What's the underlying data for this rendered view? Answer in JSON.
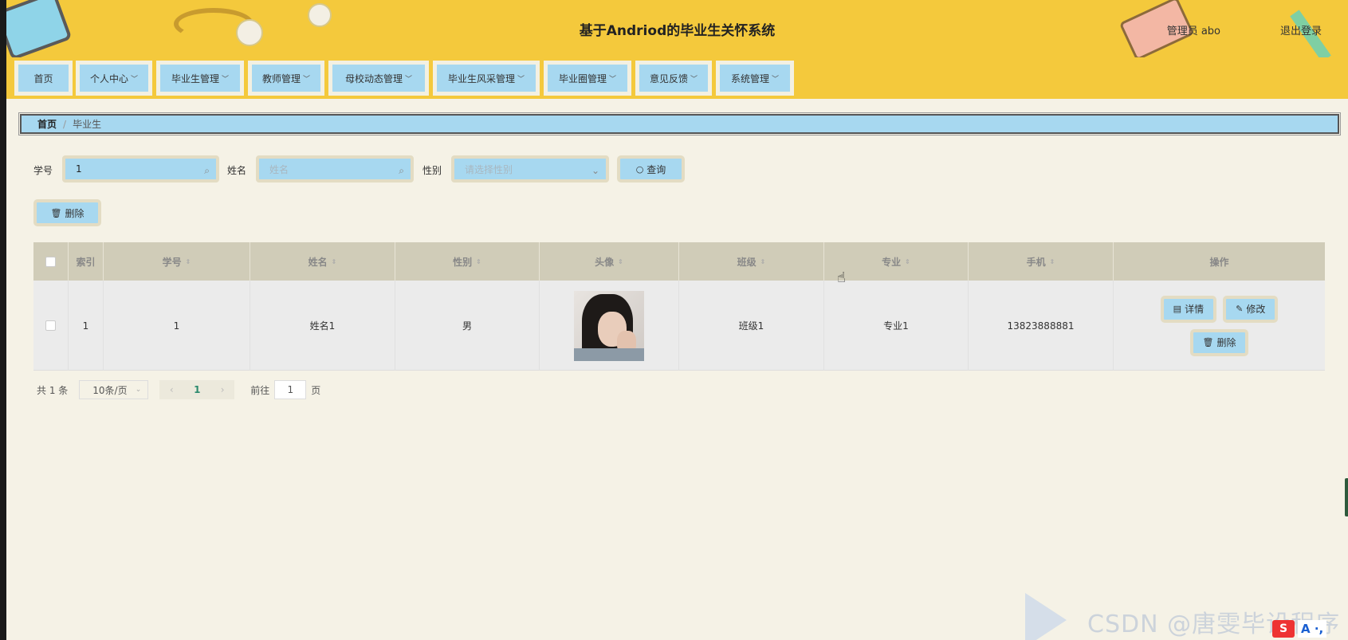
{
  "header": {
    "title": "基于Andriod的毕业生关怀系统",
    "user": "管理员 abo",
    "logout": "退出登录"
  },
  "nav": {
    "items": [
      {
        "label": "首页",
        "dropdown": false
      },
      {
        "label": "个人中心",
        "dropdown": true
      },
      {
        "label": "毕业生管理",
        "dropdown": true
      },
      {
        "label": "教师管理",
        "dropdown": true
      },
      {
        "label": "母校动态管理",
        "dropdown": true
      },
      {
        "label": "毕业生风采管理",
        "dropdown": true
      },
      {
        "label": "毕业圈管理",
        "dropdown": true
      },
      {
        "label": "意见反馈",
        "dropdown": true
      },
      {
        "label": "系统管理",
        "dropdown": true
      }
    ],
    "chevron": "﹀"
  },
  "breadcrumb": {
    "home": "首页",
    "separator": "/",
    "current": "毕业生"
  },
  "search": {
    "xuehao_label": "学号",
    "xuehao_value": "1",
    "xingming_label": "姓名",
    "xingming_placeholder": "姓名",
    "xingbie_label": "性别",
    "xingbie_placeholder": "请选择性别",
    "query_button": "查询"
  },
  "toolbar": {
    "delete_button": "删除"
  },
  "table": {
    "columns": [
      "索引",
      "学号",
      "姓名",
      "性别",
      "头像",
      "班级",
      "专业",
      "手机",
      "操作"
    ],
    "rows": [
      {
        "index": "1",
        "xuehao": "1",
        "xingming": "姓名1",
        "xingbie": "男",
        "banji": "班级1",
        "zhuanye": "专业1",
        "shouji": "13823888881"
      }
    ],
    "actions": {
      "detail": "详情",
      "edit": "修改",
      "delete": "删除"
    }
  },
  "pagination": {
    "total": "共 1 条",
    "page_size": "10条/页",
    "current_page": "1",
    "goto_label": "前往",
    "goto_value": "1",
    "page_suffix": "页"
  },
  "watermark": {
    "text": "CSDN @唐雯毕设程序",
    "logo": "S",
    "ime": "A ·,"
  },
  "icons": {
    "search": "search-icon",
    "delete": "trash-icon",
    "detail": "document-icon",
    "edit": "pencil-icon",
    "chevron": "chevron-down-icon"
  },
  "colors": {
    "header_bg": "#f4c93c",
    "button_bg": "#a7d8f0",
    "page_bg": "#f5f2e6",
    "table_header_bg": "#d0ccb8",
    "accent_page": "#2c8a6e"
  }
}
